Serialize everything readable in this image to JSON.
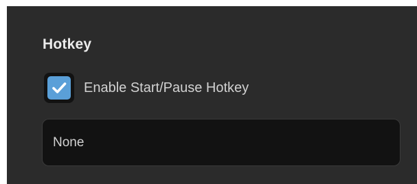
{
  "hotkey_section": {
    "title": "Hotkey",
    "enable_checkbox": {
      "label": "Enable Start/Pause Hotkey",
      "checked": true,
      "icon": "checkmark-icon"
    },
    "hotkey_input": {
      "value": "None"
    }
  },
  "colors": {
    "panel_bg": "#2b2b2b",
    "input_bg": "#121212",
    "accent": "#5a9fd8",
    "text": "#d2d2d2",
    "title_text": "#ececec"
  }
}
